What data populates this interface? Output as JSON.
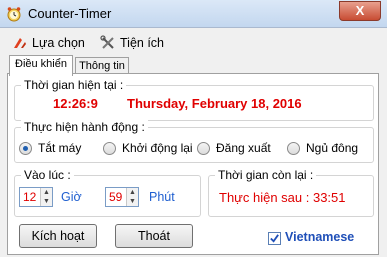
{
  "window": {
    "title": "Counter-Timer",
    "close_glyph": "X"
  },
  "menu": {
    "items": [
      {
        "label": "Lựa chọn",
        "icon": "options-icon"
      },
      {
        "label": "Tiện ích",
        "icon": "tools-icon"
      }
    ]
  },
  "tabs": {
    "items": [
      {
        "label": "Điều khiển",
        "active": true
      },
      {
        "label": "Thông tin",
        "active": false
      }
    ]
  },
  "current_time": {
    "legend": "Thời gian hiện tại :",
    "time": "12:26:9",
    "date": "Thursday, February 18, 2016"
  },
  "action": {
    "legend": "Thực hiện hành động :",
    "options": [
      {
        "label": "Tắt máy",
        "selected": true
      },
      {
        "label": "Khởi động lại",
        "selected": false
      },
      {
        "label": "Đăng xuất",
        "selected": false
      },
      {
        "label": "Ngủ đông",
        "selected": false
      }
    ]
  },
  "schedule": {
    "legend": "Vào lúc :",
    "hour_value": "12",
    "hour_unit": "Giờ",
    "minute_value": "59",
    "minute_unit": "Phút"
  },
  "remaining": {
    "legend": "Thời gian còn lại :",
    "text": "Thực hiện sau : 33:51"
  },
  "buttons": {
    "activate": "Kích hoạt",
    "exit": "Thoát"
  },
  "language": {
    "label": "Vietnamese",
    "checked": true
  },
  "colors": {
    "accent_red": "#e00000",
    "accent_blue": "#1f5fd0"
  }
}
